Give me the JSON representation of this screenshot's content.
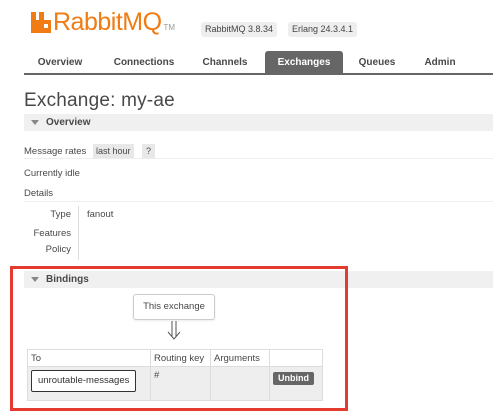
{
  "header": {
    "brand": "RabbitMQ",
    "trademark": "TM",
    "rabbitmq_version": "RabbitMQ 3.8.34",
    "erlang_version": "Erlang 24.3.4.1",
    "brand_color": "#f07c13"
  },
  "tabs": [
    {
      "label": "Overview",
      "active": false
    },
    {
      "label": "Connections",
      "active": false
    },
    {
      "label": "Channels",
      "active": false
    },
    {
      "label": "Exchanges",
      "active": true
    },
    {
      "label": "Queues",
      "active": false
    },
    {
      "label": "Admin",
      "active": false
    }
  ],
  "page_title": "Exchange: my-ae",
  "overview": {
    "section_label": "Overview",
    "message_rates_label": "Message rates",
    "message_rates_value": "last hour",
    "help": "?",
    "status": "Currently idle",
    "details_label": "Details",
    "type_label": "Type",
    "type_value": "fanout",
    "features_label": "Features",
    "policy_label": "Policy"
  },
  "bindings": {
    "section_label": "Bindings",
    "this_exchange": "This exchange",
    "columns": [
      "To",
      "Routing key",
      "Arguments",
      ""
    ],
    "rows": [
      {
        "to": "unroutable-messages",
        "routing_key": "#",
        "arguments": "",
        "action": "Unbind"
      }
    ]
  },
  "colors": {
    "highlight": "#e53a2f",
    "active_tab": "#666666"
  }
}
